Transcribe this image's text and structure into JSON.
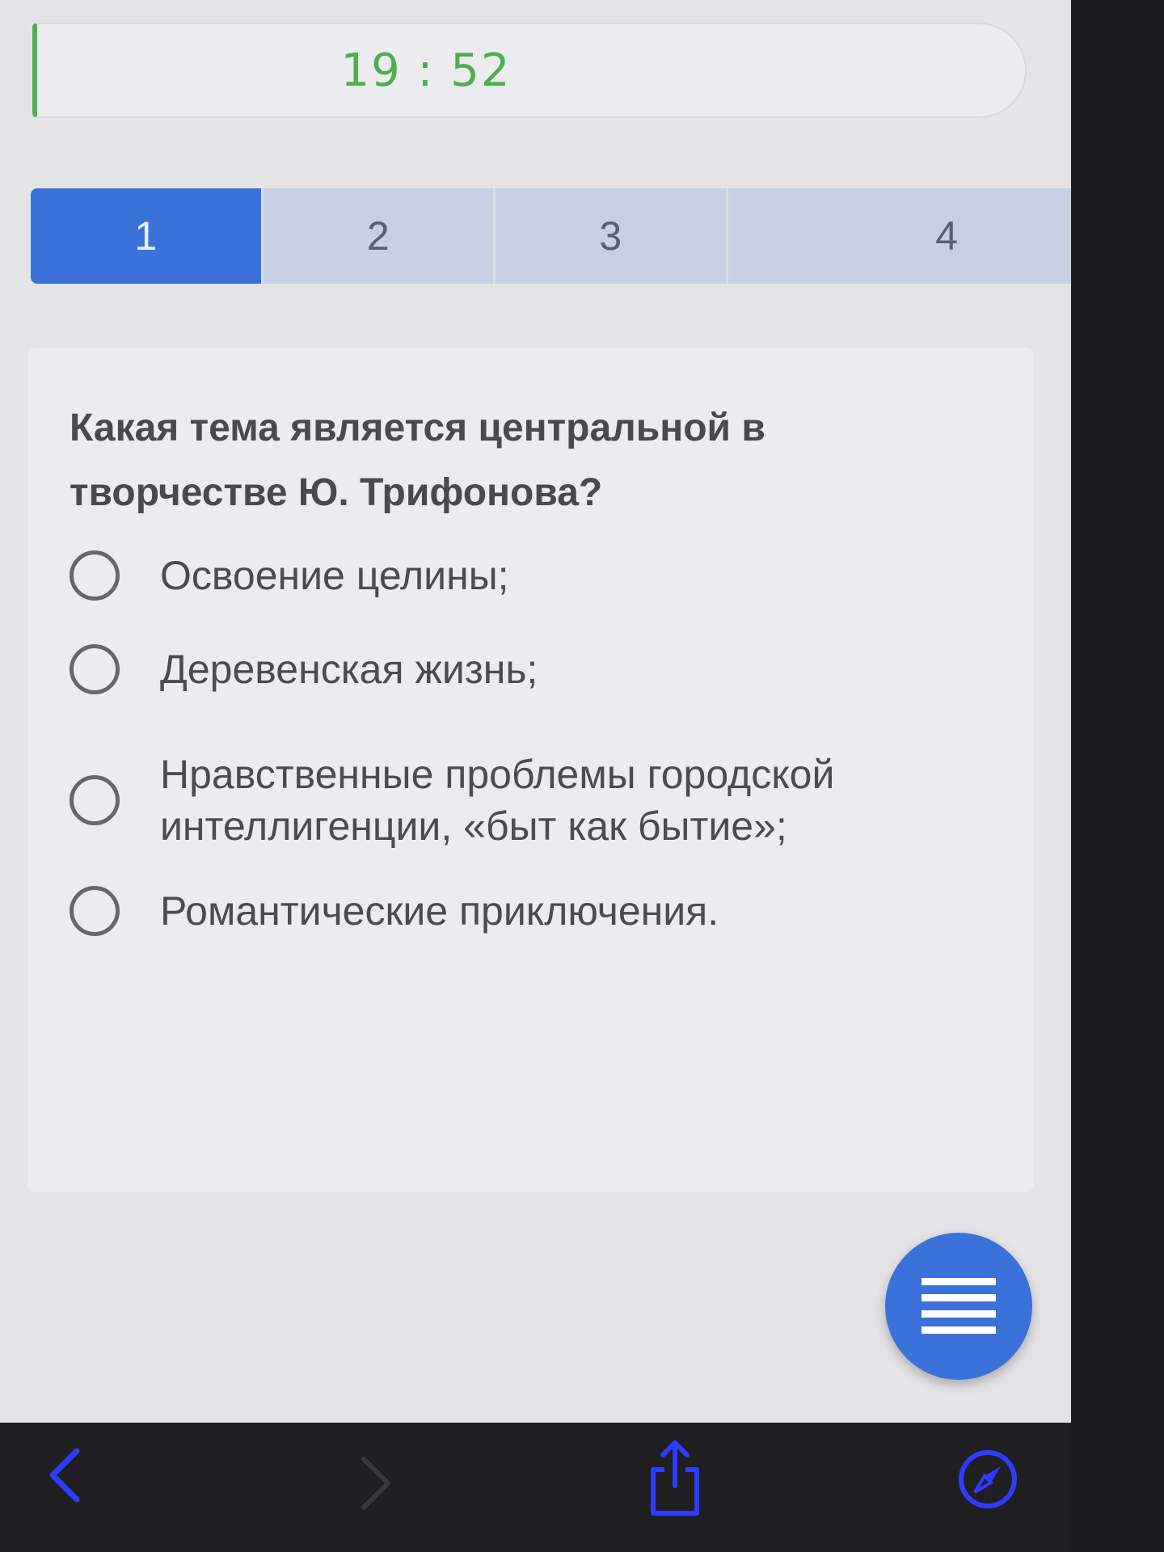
{
  "timer": {
    "value": "19 : 52",
    "color": "#4caf50"
  },
  "tabs": [
    {
      "label": "1",
      "active": true
    },
    {
      "label": "2",
      "active": false
    },
    {
      "label": "3",
      "active": false
    },
    {
      "label": "4",
      "active": false
    }
  ],
  "question": {
    "text": "Какая тема является центральной в творчестве Ю. Трифонова?",
    "options": [
      "Освоение целины;",
      "Деревенская жизнь;",
      "Нравственные проблемы городской интеллигенции, «быт как бытие»;",
      "Романтические приключения."
    ]
  },
  "icons": {
    "fab": "menu-icon",
    "back": "chevron-left-icon",
    "forward": "chevron-right-icon",
    "share": "share-icon",
    "compass": "compass-icon"
  },
  "colors": {
    "accent": "#3b72d9",
    "tab_inactive": "#c7d0e3",
    "browser_icon": "#2d3cff"
  }
}
